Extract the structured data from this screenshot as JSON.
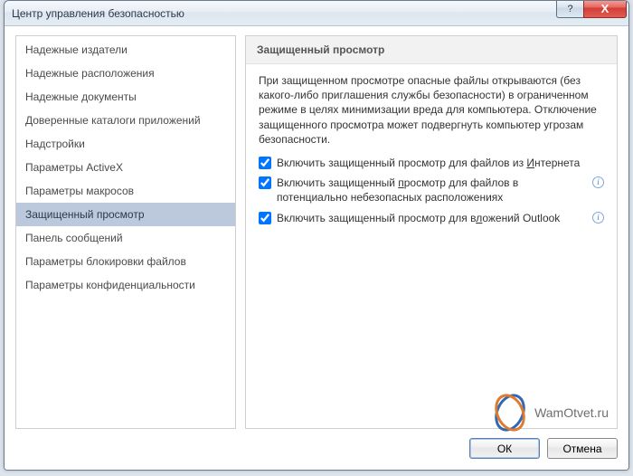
{
  "window": {
    "title": "Центр управления безопасностью",
    "help_symbol": "?",
    "close_symbol": "X"
  },
  "sidebar": {
    "items": [
      {
        "label": "Надежные издатели"
      },
      {
        "label": "Надежные расположения"
      },
      {
        "label": "Надежные документы"
      },
      {
        "label": "Доверенные каталоги приложений"
      },
      {
        "label": "Надстройки"
      },
      {
        "label": "Параметры ActiveX"
      },
      {
        "label": "Параметры макросов"
      },
      {
        "label": "Защищенный просмотр",
        "selected": true
      },
      {
        "label": "Панель сообщений"
      },
      {
        "label": "Параметры блокировки файлов"
      },
      {
        "label": "Параметры конфиденциальности"
      }
    ]
  },
  "content": {
    "heading": "Защищенный просмотр",
    "description": "При защищенном просмотре опасные файлы открываются (без какого-либо приглашения службы безопасности) в ограниченном режиме в целях минимизации вреда для компьютера. Отключение защищенного просмотра может подвергнуть компьютер угрозам безопасности.",
    "options": [
      {
        "checked": true,
        "pre": "Включить защищенный просмотр для файлов из ",
        "accel": "И",
        "post": "нтернета",
        "info": false
      },
      {
        "checked": true,
        "pre": "Включить защищенный ",
        "accel": "п",
        "post": "росмотр для файлов в потенциально небезопасных расположениях",
        "info": true
      },
      {
        "checked": true,
        "pre": "Включить защищенный просмотр для в",
        "accel": "л",
        "post": "ожений Outlook",
        "info": true
      }
    ]
  },
  "buttons": {
    "ok": "ОК",
    "cancel": "Отмена"
  },
  "watermark": {
    "text": "WamOtvet.ru"
  }
}
